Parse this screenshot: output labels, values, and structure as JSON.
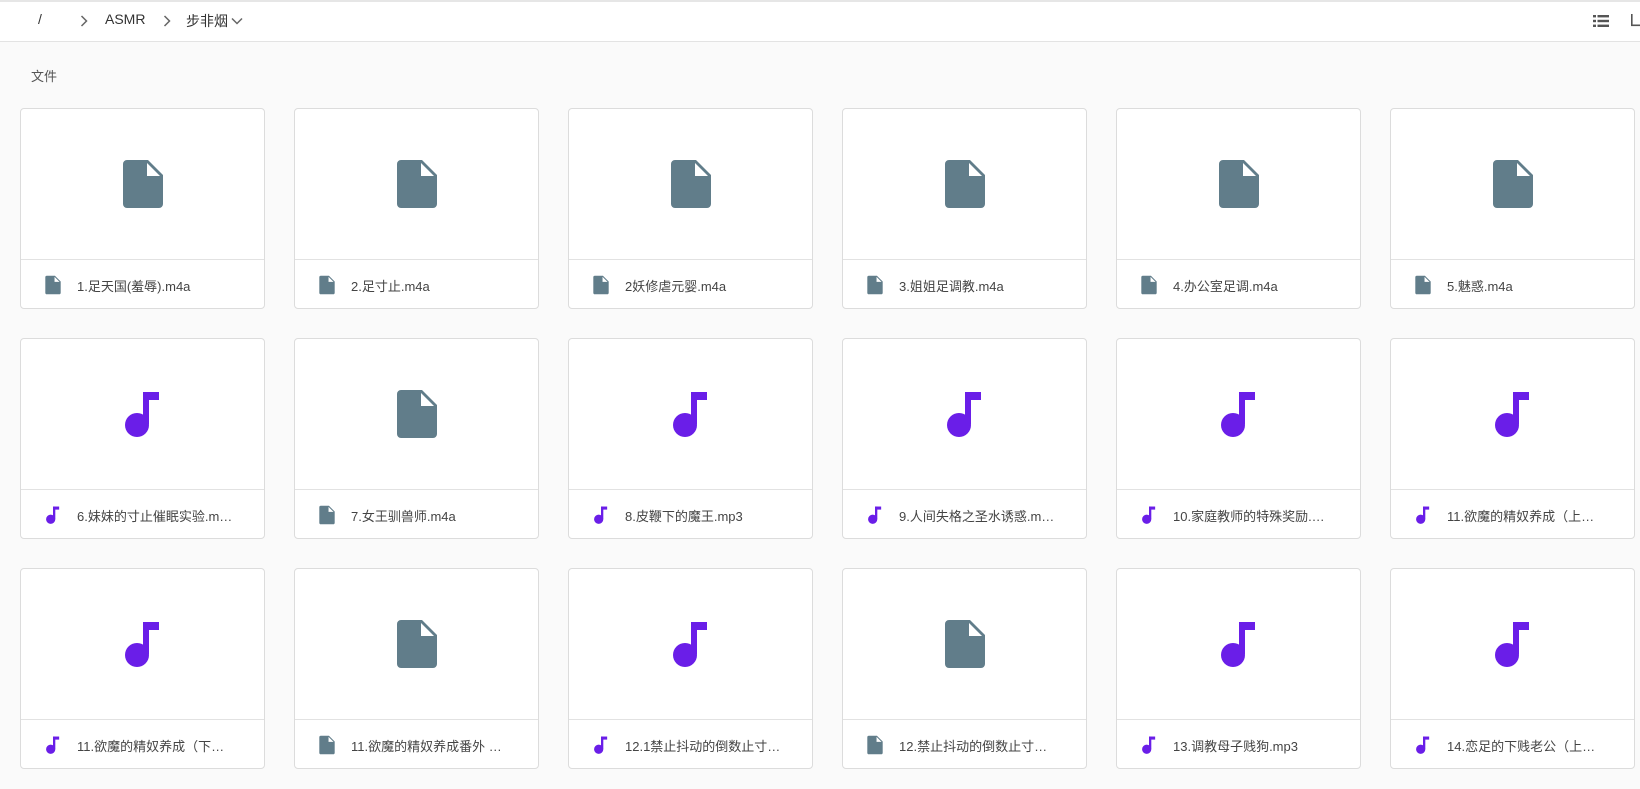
{
  "breadcrumb": {
    "root": "/",
    "items": [
      "ASMR",
      "步非烟"
    ]
  },
  "section": {
    "title": "文件"
  },
  "colors": {
    "doc_icon": "#617d8a",
    "audio_icon": "#6a1ee8"
  },
  "files": [
    {
      "name": "1.足天国(羞辱).m4a",
      "icon": "document-icon"
    },
    {
      "name": "2.足寸止.m4a",
      "icon": "document-icon"
    },
    {
      "name": "2妖修虐元婴.m4a",
      "icon": "document-icon"
    },
    {
      "name": "3.姐姐足调教.m4a",
      "icon": "document-icon"
    },
    {
      "name": "4.办公室足调.m4a",
      "icon": "document-icon"
    },
    {
      "name": "5.魅惑.m4a",
      "icon": "document-icon"
    },
    {
      "name": "6.妹妹的寸止催眠实验.m…",
      "icon": "music-note-icon"
    },
    {
      "name": "7.女王驯兽师.m4a",
      "icon": "document-icon"
    },
    {
      "name": "8.皮鞭下的魔王.mp3",
      "icon": "music-note-icon"
    },
    {
      "name": "9.人间失格之圣水诱惑.m…",
      "icon": "music-note-icon"
    },
    {
      "name": "10.家庭教师的特殊奖励.…",
      "icon": "music-note-icon"
    },
    {
      "name": "11.欲魔的精奴养成（上…",
      "icon": "music-note-icon"
    },
    {
      "name": "11.欲魔的精奴养成（下…",
      "icon": "music-note-icon"
    },
    {
      "name": "11.欲魔的精奴养成番外 …",
      "icon": "document-icon"
    },
    {
      "name": "12.1禁止抖动的倒数止寸…",
      "icon": "music-note-icon"
    },
    {
      "name": "12.禁止抖动的倒数止寸…",
      "icon": "document-icon"
    },
    {
      "name": "13.调教母子贱狗.mp3",
      "icon": "music-note-icon"
    },
    {
      "name": "14.恋足的下贱老公（上…",
      "icon": "music-note-icon"
    }
  ]
}
